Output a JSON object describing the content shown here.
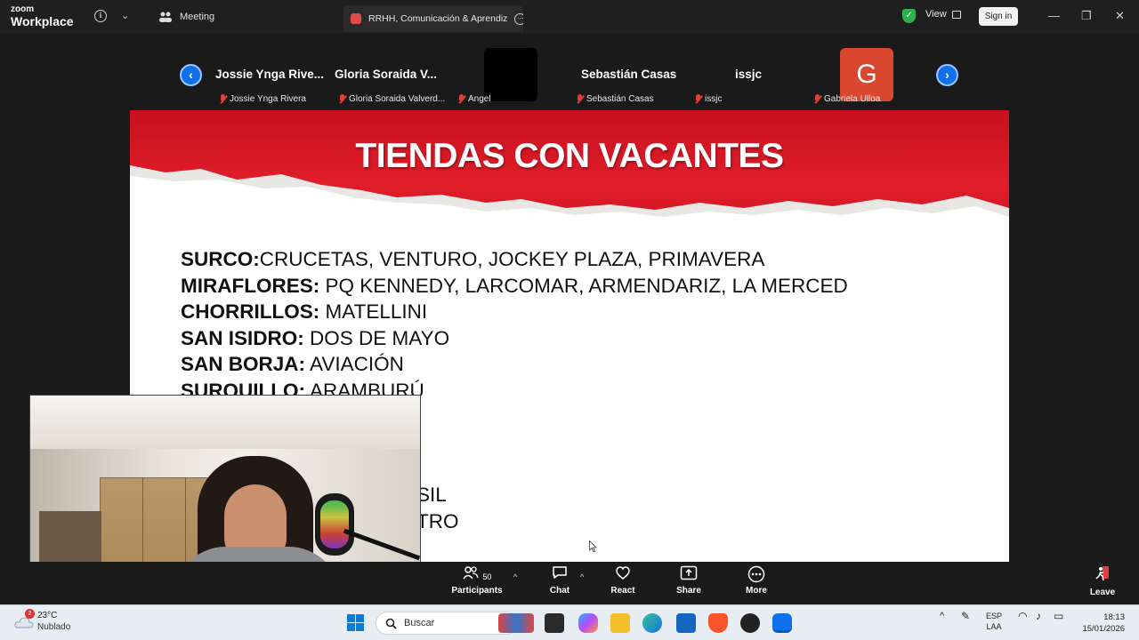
{
  "app": {
    "logo_line1": "zoom",
    "logo_line2": "Workplace",
    "meeting_tab": "Meeting",
    "active_tab": "RRHH, Comunicación & Aprendiz",
    "view_label": "View",
    "sign_in": "Sign in"
  },
  "participants": {
    "tiles": [
      {
        "name": "Jossie Ynga Rive...",
        "sub": "Jossie Ynga Rivera"
      },
      {
        "name": "Gloria Soraida V...",
        "sub": "Gloria Soraida Valverd..."
      },
      {
        "name": "",
        "sub": "Angel"
      },
      {
        "name": "Sebastián Casas",
        "sub": "Sebastián Casas"
      },
      {
        "name": "issjc",
        "sub": "issjc"
      },
      {
        "name": "G",
        "sub": "Gabriela Ulloa"
      }
    ]
  },
  "slide": {
    "title": "TIENDAS CON VACANTES",
    "lines": [
      {
        "district": "SURCO:",
        "stores": "CRUCETAS, VENTURO, JOCKEY PLAZA, PRIMAVERA"
      },
      {
        "district": "MIRAFLORES:",
        "stores": " PQ KENNEDY, LARCOMAR, ARMENDARIZ, LA MERCED"
      },
      {
        "district": "CHORRILLOS:",
        "stores": " MATELLINI"
      },
      {
        "district": "SAN ISIDRO:",
        "stores": " DOS DE MAYO"
      },
      {
        "district": "SAN BORJA:",
        "stores": " AVIACIÓN"
      },
      {
        "district": "SURQUILLO:",
        "stores": " ARAMBURÚ"
      }
    ],
    "partial_1": "SIL",
    "partial_2": "TRO"
  },
  "toolbar": {
    "participants_label": "Participants",
    "participants_count": "50",
    "chat_label": "Chat",
    "react_label": "React",
    "share_label": "Share",
    "more_label": "More",
    "leave_label": "Leave"
  },
  "taskbar": {
    "weather_temp": "23°C",
    "weather_desc": "Nublado",
    "search_placeholder": "Buscar",
    "lang_1": "ESP",
    "lang_2": "LAA",
    "time": "18:13",
    "date": "15/01/2026",
    "notif_badge": "2"
  },
  "colors": {
    "zoom_blue": "#0e71eb",
    "slide_red": "#d41723",
    "leave_red": "#e23c3c",
    "toolbar_bg": "#1a1a1a"
  }
}
